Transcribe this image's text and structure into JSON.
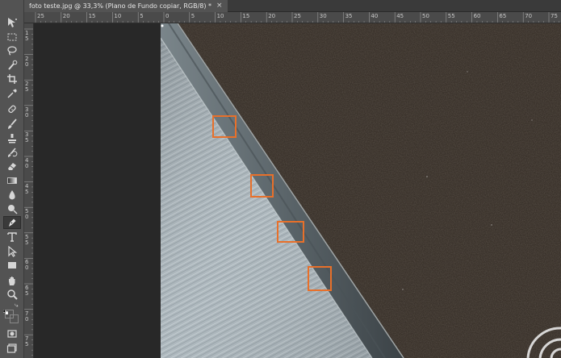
{
  "document": {
    "tab_title": "foto teste.jpg @ 33,3% (Plano de Fundo copiar, RGB/8) *",
    "close_glyph": "×"
  },
  "rulers": {
    "horizontal_labels": [
      "25",
      "20",
      "15",
      "10",
      "5",
      "0",
      "5",
      "10",
      "15",
      "20",
      "25",
      "30",
      "35",
      "40",
      "45",
      "50",
      "55",
      "60",
      "65",
      "70",
      "75"
    ],
    "vertical_labels": [
      "1\n5",
      "2\n0",
      "2\n5",
      "3\n0",
      "3\n5",
      "4\n0",
      "4\n5",
      "5\n0",
      "5\n5",
      "6\n0",
      "6\n5",
      "7\n0",
      "7\n5"
    ]
  },
  "tools": [
    {
      "name": "move-tool-icon"
    },
    {
      "name": "rectangular-marquee-tool-icon"
    },
    {
      "name": "lasso-tool-icon"
    },
    {
      "name": "quick-selection-tool-icon"
    },
    {
      "name": "crop-tool-icon"
    },
    {
      "name": "eyedropper-tool-icon"
    },
    {
      "name": "spot-healing-brush-icon"
    },
    {
      "name": "brush-tool-icon"
    },
    {
      "name": "clone-stamp-tool-icon"
    },
    {
      "name": "history-brush-icon"
    },
    {
      "name": "eraser-tool-icon"
    },
    {
      "name": "gradient-tool-icon"
    },
    {
      "name": "blur-tool-icon"
    },
    {
      "name": "dodge-tool-icon"
    },
    {
      "name": "pen-tool-icon"
    },
    {
      "name": "type-tool-icon"
    },
    {
      "name": "path-selection-tool-icon"
    },
    {
      "name": "rectangle-tool-icon"
    },
    {
      "name": "hand-tool-icon"
    },
    {
      "name": "zoom-tool-icon"
    },
    {
      "name": "foreground-background-colors-icon"
    },
    {
      "name": "quick-mask-icon"
    },
    {
      "name": "screen-mode-icon"
    }
  ],
  "colors": {
    "foreground": "#000000",
    "background": "#ffffff",
    "highlight_box": "#e8702a",
    "tool_active": "#3a3a3a"
  }
}
